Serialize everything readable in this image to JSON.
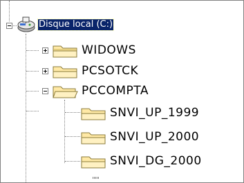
{
  "tree": {
    "root": {
      "label": "Disque local (C:)",
      "icon": "hard-drive-icon",
      "state": "expanded",
      "selected": true
    },
    "folders": [
      {
        "label": "WIDOWS",
        "icon": "folder-icon",
        "state": "collapsed"
      },
      {
        "label": "PCSOTCK",
        "icon": "folder-icon",
        "state": "collapsed"
      },
      {
        "label": "PCCOMPTA",
        "icon": "folder-icon",
        "state": "expanded"
      }
    ],
    "subfolders": [
      {
        "label": "SNVI_UP_1999",
        "icon": "folder-icon"
      },
      {
        "label": "SNVI_UP_2000",
        "icon": "folder-icon"
      },
      {
        "label": "SNVI_DG_2000",
        "icon": "folder-icon"
      }
    ]
  },
  "colors": {
    "selection_bg": "#0a246a",
    "selection_text": "#ffffff",
    "folder_fill": "#ffe9a6",
    "folder_outline": "#8a7a3a",
    "connector": "#808080"
  }
}
